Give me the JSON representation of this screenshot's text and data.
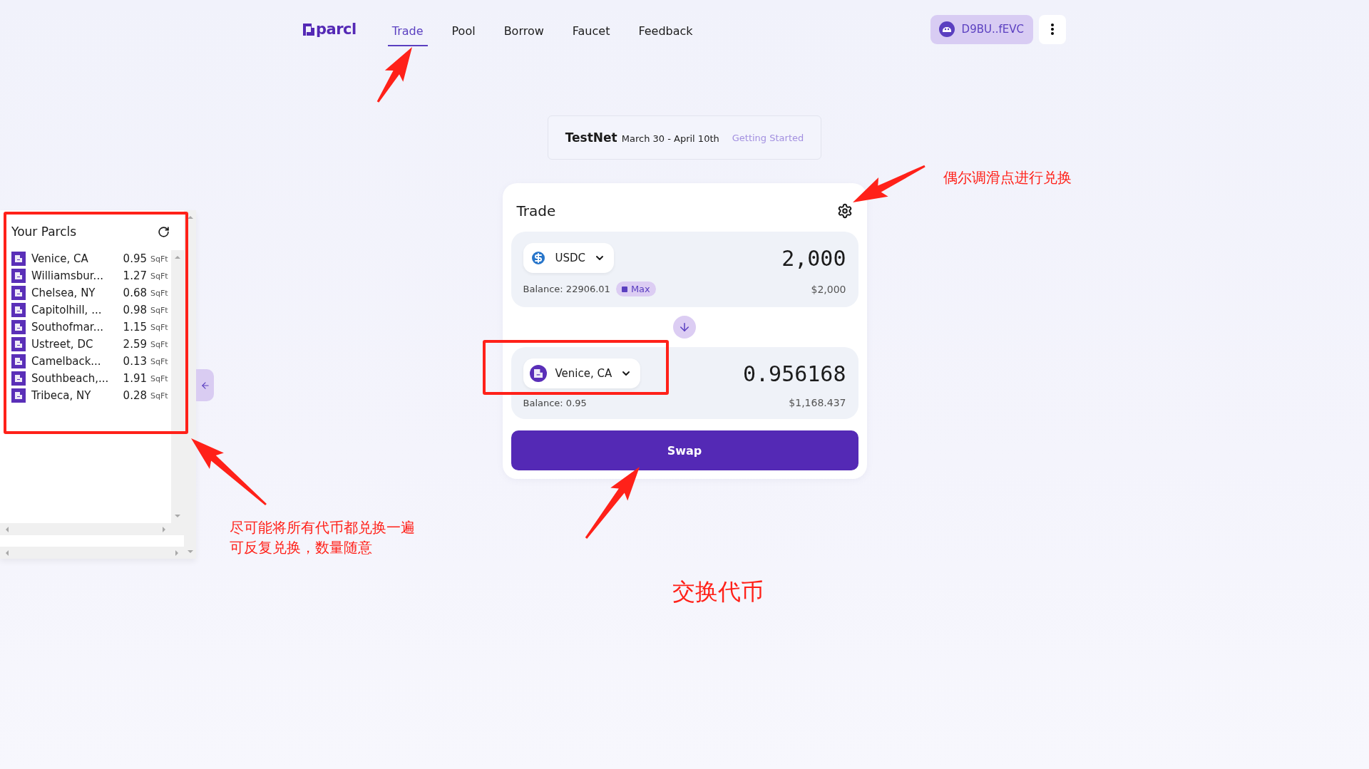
{
  "header": {
    "logo": "parcl",
    "nav": [
      {
        "label": "Trade",
        "selected": true
      },
      {
        "label": "Pool",
        "selected": false
      },
      {
        "label": "Borrow",
        "selected": false
      },
      {
        "label": "Faucet",
        "selected": false
      },
      {
        "label": "Feedback",
        "selected": false
      }
    ],
    "wallet": "D9BU..fEVC"
  },
  "banner": {
    "title": "TestNet",
    "dates": "March 30 - April 10th",
    "link": "Getting Started"
  },
  "parcels_panel": {
    "title": "Your Parcls",
    "items": [
      {
        "name": "Venice, CA",
        "amount": "0.95",
        "unit": "SqFt"
      },
      {
        "name": "Williamsbur...",
        "amount": "1.27",
        "unit": "SqFt"
      },
      {
        "name": "Chelsea, NY",
        "amount": "0.68",
        "unit": "SqFt"
      },
      {
        "name": "Capitolhill, ...",
        "amount": "0.98",
        "unit": "SqFt"
      },
      {
        "name": "Southofmar...",
        "amount": "1.15",
        "unit": "SqFt"
      },
      {
        "name": "Ustreet, DC",
        "amount": "2.59",
        "unit": "SqFt"
      },
      {
        "name": "Camelback...",
        "amount": "0.13",
        "unit": "SqFt"
      },
      {
        "name": "Southbeach,...",
        "amount": "1.91",
        "unit": "SqFt"
      },
      {
        "name": "Tribeca, NY",
        "amount": "0.28",
        "unit": "SqFt"
      }
    ]
  },
  "trade": {
    "title": "Trade",
    "from": {
      "kind": "usdc",
      "token": "USDC",
      "amount": "2,000",
      "balance": "Balance: 22906.01",
      "max": "Max",
      "usd": "$2,000"
    },
    "to": {
      "kind": "parcel",
      "token": "Venice, CA",
      "amount": "0.956168",
      "balance": "Balance: 0.95",
      "usd": "$1,168.437"
    },
    "button": "Swap"
  },
  "annotations": [
    {
      "text": "偶尔调滑点进行兑换"
    },
    {
      "text": "尽可能将所有代币都兑换一遍"
    },
    {
      "text": "可反复兑换，数量随意"
    },
    {
      "text": "交换代币"
    }
  ]
}
